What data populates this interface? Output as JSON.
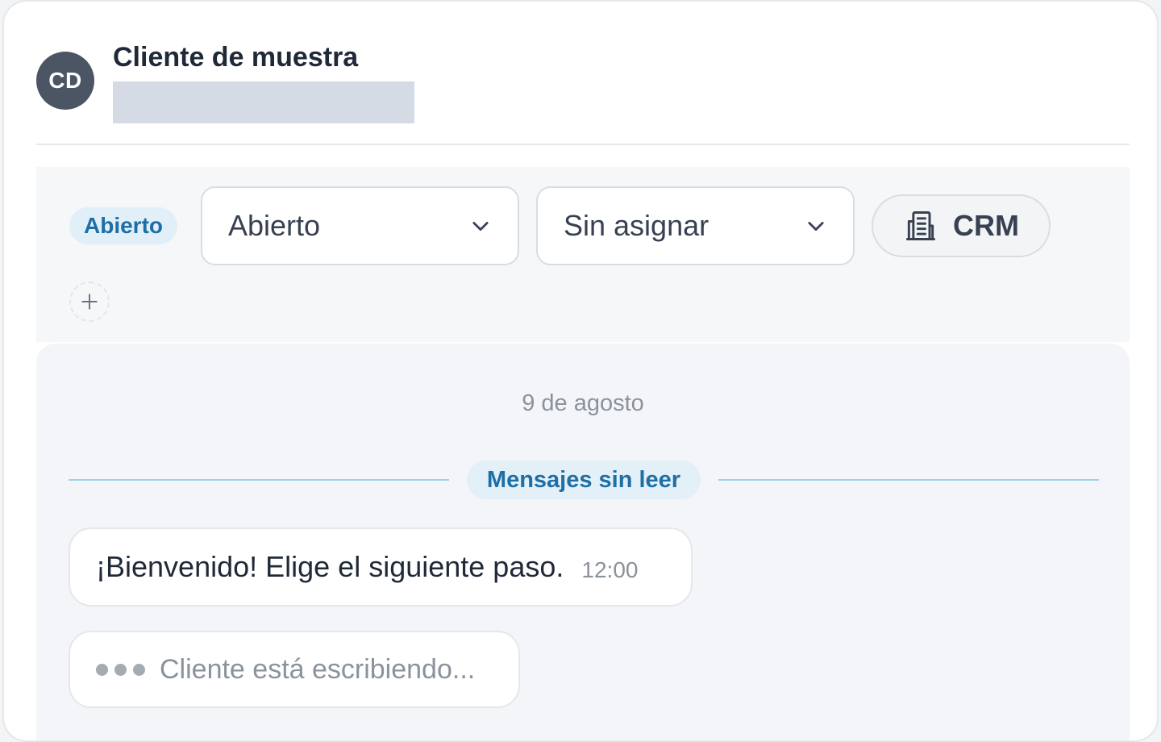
{
  "contact": {
    "initials": "CD",
    "name": "Cliente de muestra"
  },
  "toolbar": {
    "status_badge": "Abierto",
    "status_select_value": "Abierto",
    "assignee_select_value": "Sin asignar",
    "crm_label": "CRM",
    "add_tag_icon": "plus-icon",
    "crm_icon": "building-icon"
  },
  "chat": {
    "date_separator": "9 de agosto",
    "unread_label": "Mensajes sin leer",
    "messages": [
      {
        "text": "¡Bienvenido! Elige el siguiente paso.",
        "time": "12:00"
      }
    ],
    "typing_indicator": "Cliente está escribiendo..."
  },
  "colors": {
    "accent": "#1d6fa5",
    "badge_bg": "#e1eff8",
    "avatar_bg": "#4b5563",
    "unread_line": "#9fd0e8"
  }
}
